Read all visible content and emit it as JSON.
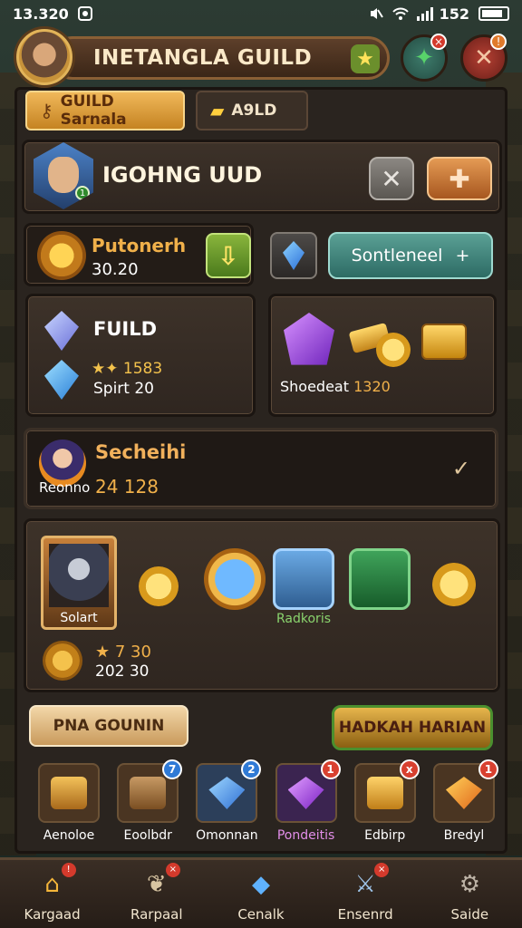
{
  "status_bar": {
    "time": "13.320",
    "battery_text": "152"
  },
  "header": {
    "title": "INETANGLA GUILD"
  },
  "tabs": [
    {
      "label": "GUILD Sarnala",
      "active": true
    },
    {
      "label": "A9LD",
      "active": false
    }
  ],
  "guild": {
    "name": "IGOHNG UUD",
    "level_badge": "1"
  },
  "resource": {
    "name": "Putonerh",
    "value": "30.20"
  },
  "action_button": {
    "label": "Sontleneel",
    "icon": "+"
  },
  "fuild_card": {
    "title": "FUILD",
    "stars_value": "1583",
    "spirit_label": "Spirt 20"
  },
  "shop_card": {
    "label_prefix": "Shoedeat",
    "label_value": "1320"
  },
  "hero": {
    "name": "Secheihi",
    "sub": "Reonno",
    "score": "24 128"
  },
  "rewards": {
    "portrait_caption": "Solart",
    "second_portrait_caption": "Radkoris",
    "bottom_value_1": "7 30",
    "bottom_value_2": "202 30"
  },
  "buttons": {
    "left": "PNA GOUNIN",
    "right": "HADKAH HARIAN"
  },
  "items": [
    {
      "label": "Aenoloe",
      "badge": "",
      "color": "#c2852a"
    },
    {
      "label": "Eoolbdr",
      "badge": "7",
      "color": "#8a5a2c"
    },
    {
      "label": "Omonnan",
      "badge": "2",
      "color": "#3f79c8"
    },
    {
      "label": "Pondeitis",
      "badge": "1",
      "color": "#9a3ac8",
      "label_color": "purple"
    },
    {
      "label": "Edbirp",
      "badge": "x",
      "color": "#c77a24"
    },
    {
      "label": "Bredyl",
      "badge": "1",
      "color": "#d36a1c"
    }
  ],
  "nav": [
    {
      "label": "Kargaad",
      "icon": "house-icon"
    },
    {
      "label": "Rarpaal",
      "icon": "scroll-icon"
    },
    {
      "label": "Cenalk",
      "icon": "crystal-icon"
    },
    {
      "label": "Ensenrd",
      "icon": "sword-icon"
    },
    {
      "label": "Saide",
      "icon": "gear-icon"
    }
  ]
}
